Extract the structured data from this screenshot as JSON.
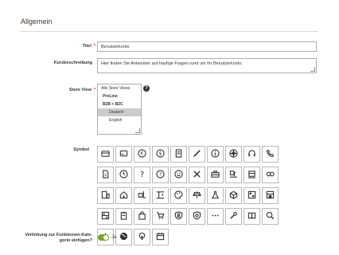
{
  "section": {
    "title": "Allgemein"
  },
  "fields": {
    "title_label": "Titel",
    "required_mark": "*",
    "title_value": "Benutzerkonto",
    "summary_label": "Kurzbeschreibung",
    "summary_value": "Hier finden Sie Antworten auf häufige Fragen rund um Ihr Benutzerkonto.",
    "store_view_label": "Store View",
    "required_mark_2": "*",
    "help_mark": "?"
  },
  "store_view": {
    "options": [
      {
        "label": "Alle Store Views",
        "kind": "option",
        "selected": false
      },
      {
        "label": "ProLine",
        "kind": "group",
        "selected": false
      },
      {
        "label": "B2B + B2C",
        "kind": "group",
        "selected": false
      },
      {
        "label": "Deutsch",
        "kind": "sub",
        "selected": true
      },
      {
        "label": "English",
        "kind": "sub",
        "selected": false
      }
    ]
  },
  "symbol": {
    "label": "Symbol",
    "icons": [
      "credit-card-icon",
      "card-icon",
      "euro-icon",
      "dollar-icon",
      "invoice-icon",
      "pencil-icon",
      "info-icon",
      "lifebuoy-icon",
      "headset-icon",
      "phone-icon",
      "document-icon",
      "clock-icon",
      "question-icon",
      "help-circle-icon",
      "smiley-icon",
      "tools-icon",
      "toolbox-icon",
      "delivery-icon",
      "shipping-box-icon",
      "parcels-icon",
      "storage-icon",
      "home-icon",
      "forklift-icon",
      "crane-icon",
      "palette-icon",
      "scale-icon",
      "flask-icon",
      "cube-icon",
      "packages-icon",
      "warehouse-icon",
      "shelf-icon",
      "clipboard-icon",
      "shopping-bag-icon",
      "cart-icon",
      "shield-user-icon",
      "shield-icon",
      "dots-icon",
      "wrench-icon",
      "book-icon",
      "search-icon",
      "download-icon",
      "globe-icon",
      "touch-icon",
      "calendar-icon"
    ]
  },
  "link": {
    "label_line1": "Verlinkung zur Funktionen-Kate-",
    "label_line2": "gorie einfügen?",
    "toggle_value": "Ja"
  },
  "colors": {
    "accent": "#79a22e",
    "required": "#e22626"
  }
}
